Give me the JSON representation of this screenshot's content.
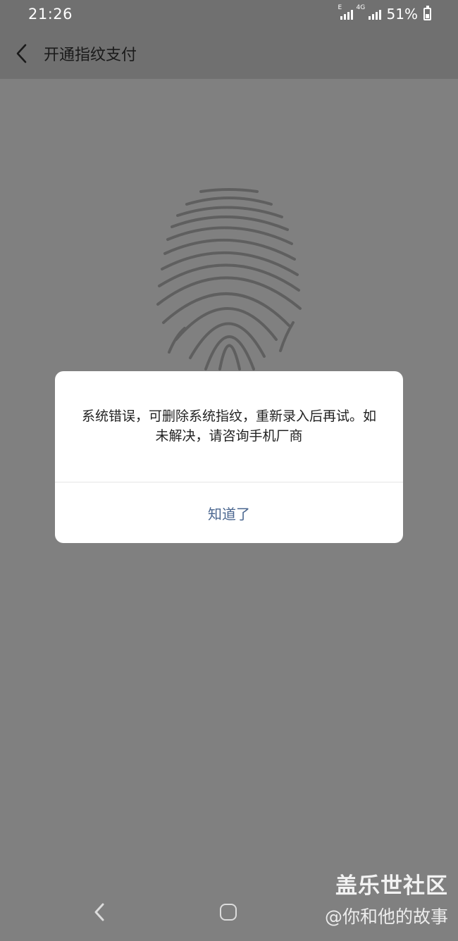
{
  "status_bar": {
    "time": "21:26",
    "network_1": "E",
    "network_2": "4G",
    "battery_percent": "51%"
  },
  "header": {
    "back_icon": "chevron-left-icon",
    "title": "开通指纹支付"
  },
  "fingerprint_icon": "fingerprint-icon",
  "dialog": {
    "message": "系统错误，可删除系统指纹，重新录入后再试。如未解决，请咨询手机厂商",
    "button_label": "知道了",
    "button_color": "#4b6790"
  },
  "nav": {
    "back_icon": "back-triangle-icon",
    "home_icon": "home-icon"
  },
  "watermark": {
    "line1": "盖乐世社区",
    "line2": "@你和他的故事"
  },
  "colors": {
    "overlay_bg": "#808080",
    "header_bg": "#707070",
    "dialog_bg": "#ffffff"
  }
}
